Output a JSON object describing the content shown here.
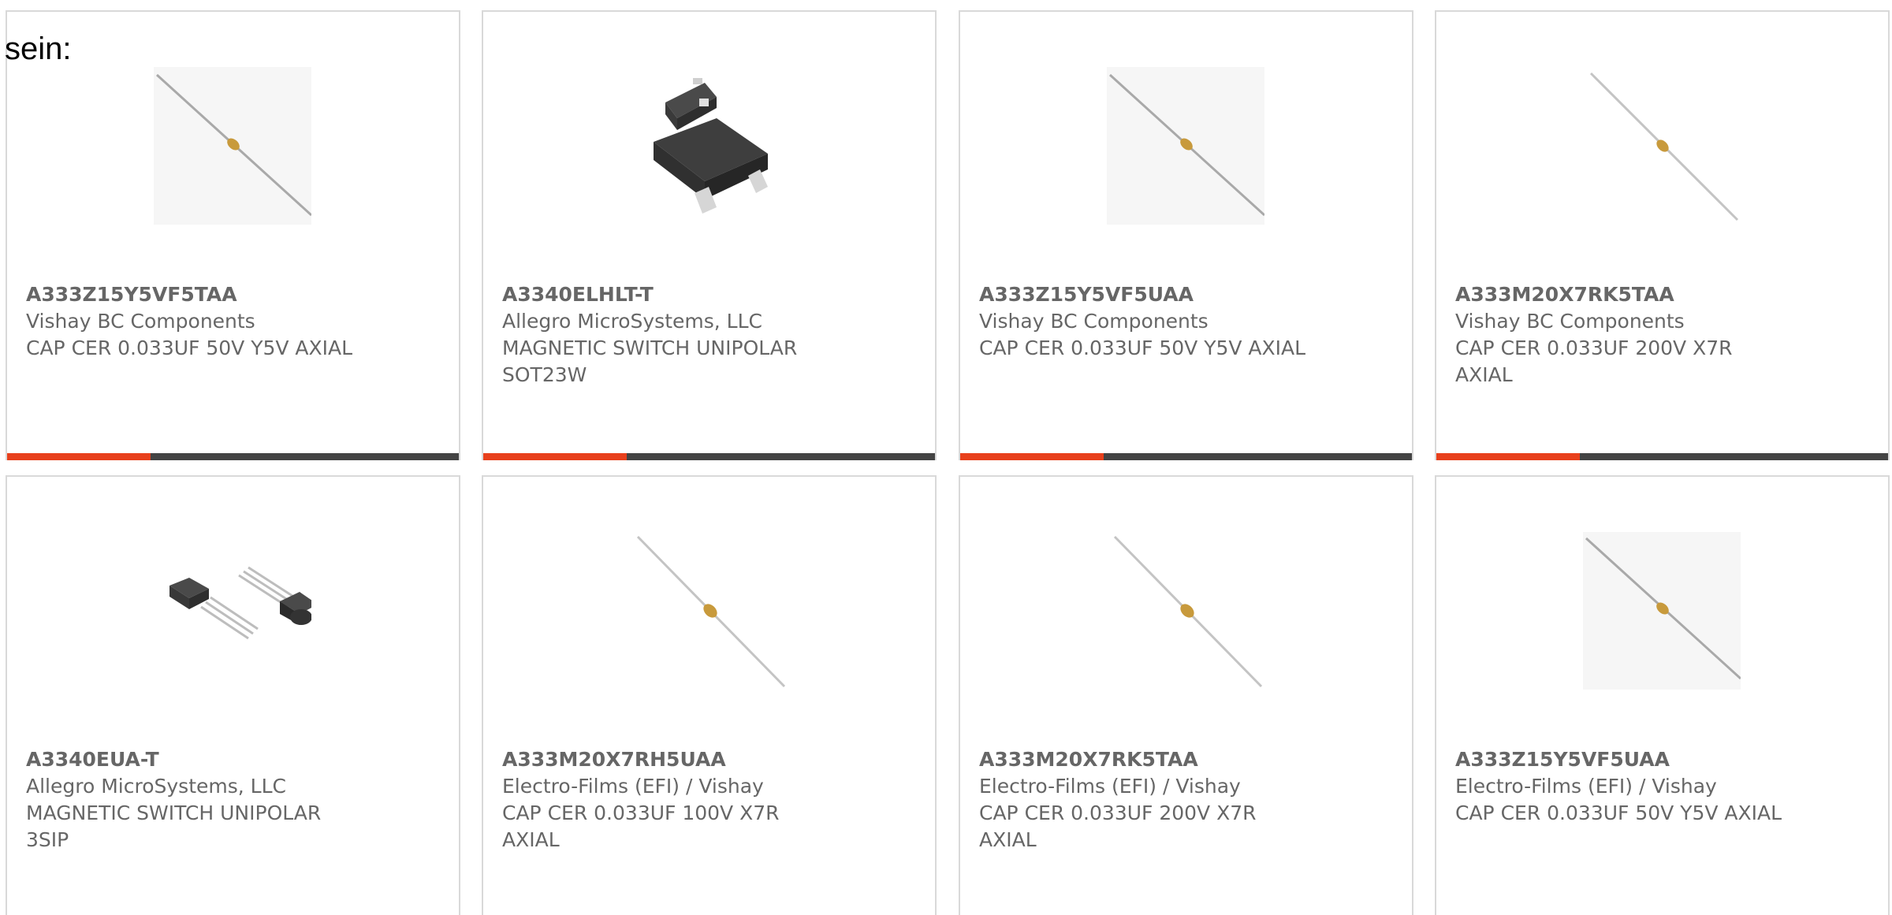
{
  "intro_text": "sein:",
  "accent_color": "#e8401c",
  "bar_color": "#444444",
  "products": [
    {
      "part": "A333Z15Y5VF5TAA",
      "manufacturer": "Vishay BC Components",
      "description": "CAP CER 0.033UF 50V Y5V AXIAL",
      "image": "axial-capacitor-icon"
    },
    {
      "part": "A3340ELHLT-T",
      "manufacturer": "Allegro MicroSystems, LLC",
      "description": "MAGNETIC SWITCH UNIPOLAR SOT23W",
      "image": "sot23-package-icon"
    },
    {
      "part": "A333Z15Y5VF5UAA",
      "manufacturer": "Vishay BC Components",
      "description": "CAP CER 0.033UF 50V Y5V AXIAL",
      "image": "axial-capacitor-icon"
    },
    {
      "part": "A333M20X7RK5TAA",
      "manufacturer": "Vishay BC Components",
      "description": "CAP CER 0.033UF 200V X7R AXIAL",
      "image": "axial-capacitor-icon"
    },
    {
      "part": "A3340EUA-T",
      "manufacturer": "Allegro MicroSystems, LLC",
      "description": "MAGNETIC SWITCH UNIPOLAR 3SIP",
      "image": "sip3-package-icon"
    },
    {
      "part": "A333M20X7RH5UAA",
      "manufacturer": "Electro-Films (EFI) / Vishay",
      "description": "CAP CER 0.033UF 100V X7R AXIAL",
      "image": "axial-capacitor-icon"
    },
    {
      "part": "A333M20X7RK5TAA",
      "manufacturer": "Electro-Films (EFI) / Vishay",
      "description": "CAP CER 0.033UF 200V X7R AXIAL",
      "image": "axial-capacitor-icon"
    },
    {
      "part": "A333Z15Y5VF5UAA",
      "manufacturer": "Electro-Films (EFI) / Vishay",
      "description": "CAP CER 0.033UF 50V Y5V AXIAL",
      "image": "axial-capacitor-icon"
    }
  ]
}
